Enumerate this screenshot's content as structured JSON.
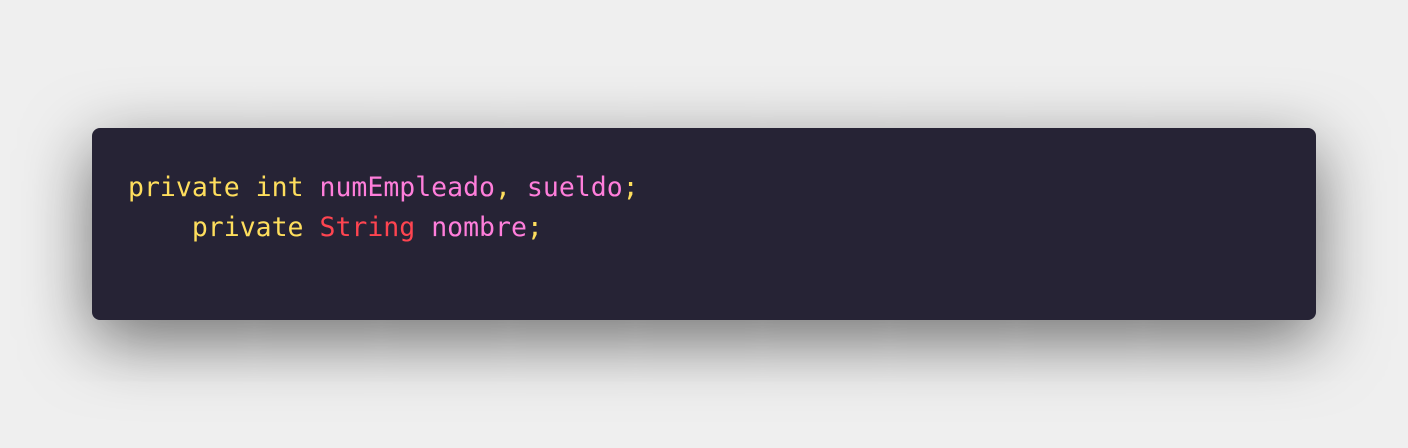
{
  "colors": {
    "page_background": "#efefef",
    "editor_background": "#262335",
    "keyword": "#fede5d",
    "type": "#fe4450",
    "identifier": "#ff7edb",
    "punctuation": "#fede5d"
  },
  "code": {
    "lines": [
      {
        "tokens": [
          {
            "text": "private",
            "kind": "keyword"
          },
          {
            "text": " ",
            "kind": "space"
          },
          {
            "text": "int",
            "kind": "keyword"
          },
          {
            "text": " ",
            "kind": "space"
          },
          {
            "text": "numEmpleado",
            "kind": "identifier"
          },
          {
            "text": ", ",
            "kind": "punctuation"
          },
          {
            "text": "sueldo",
            "kind": "identifier"
          },
          {
            "text": ";",
            "kind": "punctuation"
          }
        ]
      },
      {
        "tokens": [
          {
            "text": "    ",
            "kind": "space"
          },
          {
            "text": "private",
            "kind": "keyword"
          },
          {
            "text": " ",
            "kind": "space"
          },
          {
            "text": "String",
            "kind": "type"
          },
          {
            "text": " ",
            "kind": "space"
          },
          {
            "text": "nombre",
            "kind": "identifier"
          },
          {
            "text": ";",
            "kind": "punctuation"
          }
        ]
      }
    ]
  }
}
